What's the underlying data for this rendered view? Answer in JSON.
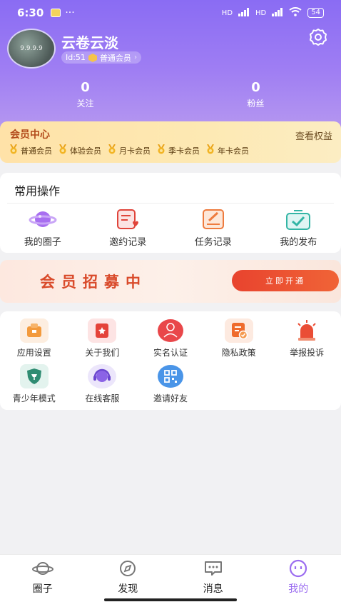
{
  "status": {
    "time": "6:30",
    "dots": "···",
    "battery": "54",
    "network_1": "HD",
    "network_2": "HD"
  },
  "profile": {
    "username": "云卷云淡",
    "id_label": "Id:51",
    "member_label": "普通会员",
    "avatar_text": "9.9.9.9"
  },
  "stats": [
    {
      "value": "0",
      "label": "关注"
    },
    {
      "value": "0",
      "label": "粉丝"
    }
  ],
  "vip": {
    "title": "会员中心",
    "link": "查看权益",
    "levels": [
      "普通会员",
      "体验会员",
      "月卡会员",
      "季卡会员",
      "年卡会员"
    ]
  },
  "ops": {
    "title": "常用操作",
    "items": [
      {
        "label": "我的圈子",
        "icon": "planet-icon"
      },
      {
        "label": "邀约记录",
        "icon": "invite-record-icon"
      },
      {
        "label": "任务记录",
        "icon": "task-record-icon"
      },
      {
        "label": "我的发布",
        "icon": "publish-icon"
      }
    ]
  },
  "recruit": {
    "text": "会员招募中",
    "button": "立即开通"
  },
  "tools": [
    {
      "label": "应用设置",
      "icon": "app-settings-icon"
    },
    {
      "label": "关于我们",
      "icon": "about-us-icon"
    },
    {
      "label": "实名认证",
      "icon": "real-name-icon"
    },
    {
      "label": "隐私政策",
      "icon": "privacy-icon"
    },
    {
      "label": "举报投诉",
      "icon": "report-icon"
    },
    {
      "label": "青少年模式",
      "icon": "teen-mode-icon"
    },
    {
      "label": "在线客服",
      "icon": "customer-service-icon"
    },
    {
      "label": "邀请好友",
      "icon": "qr-invite-icon"
    }
  ],
  "tabs": [
    {
      "label": "圈子",
      "icon": "planet-tab-icon"
    },
    {
      "label": "发现",
      "icon": "compass-tab-icon"
    },
    {
      "label": "消息",
      "icon": "message-tab-icon"
    },
    {
      "label": "我的",
      "icon": "profile-tab-icon"
    }
  ],
  "colors": {
    "header_top": "#8a6cf3",
    "accent": "#9b6cf0",
    "vip_title": "#b24a1a",
    "recruit_red": "#d94a2a"
  }
}
